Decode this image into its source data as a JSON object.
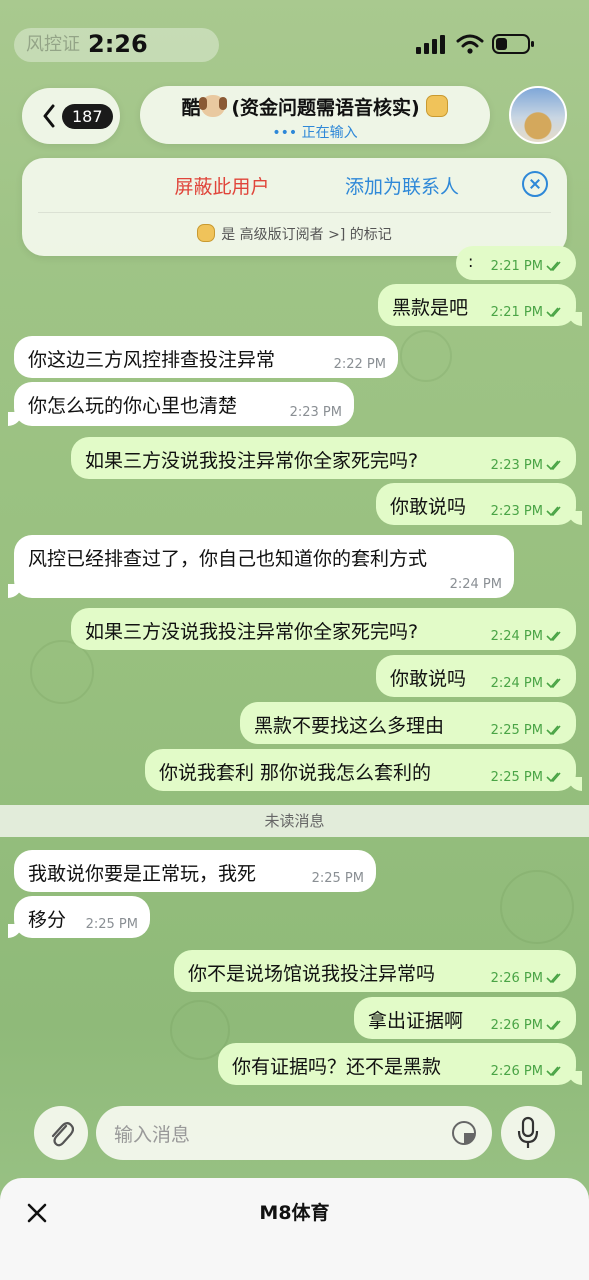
{
  "status_bar": {
    "time": "2:26",
    "faded_preview": "风控证"
  },
  "header": {
    "back_count": "187",
    "title": "酷",
    "title_rest": "(资金问题需语音核实)",
    "subtitle": "••• 正在输入"
  },
  "banner": {
    "block_label": "屏蔽此用户",
    "add_contact_label": "添加为联系人",
    "note_prefix": "是",
    "note_link": "高级版订阅者 >]",
    "note_suffix": "的标记"
  },
  "messages": [
    {
      "dir": "out",
      "text": ":",
      "time": "2:21 PM"
    },
    {
      "dir": "out",
      "text": "黑款是吧",
      "time": "2:21 PM"
    },
    {
      "dir": "in",
      "text": "你这边三方风控排查投注异常",
      "time": "2:22 PM"
    },
    {
      "dir": "in",
      "text": "你怎么玩的你心里也清楚",
      "time": "2:23 PM"
    },
    {
      "dir": "out",
      "text": "如果三方没说我投注异常你全家死完吗?",
      "time": "2:23 PM"
    },
    {
      "dir": "out",
      "text": "你敢说吗",
      "time": "2:23 PM"
    },
    {
      "dir": "in",
      "text": "风控已经排查过了，你自己也知道你的套利方式",
      "time": "2:24 PM"
    },
    {
      "dir": "out",
      "text": "如果三方没说我投注异常你全家死完吗?",
      "time": "2:24 PM"
    },
    {
      "dir": "out",
      "text": "你敢说吗",
      "time": "2:24 PM"
    },
    {
      "dir": "out",
      "text": "黑款不要找这么多理由",
      "time": "2:25 PM"
    },
    {
      "dir": "out",
      "text": "你说我套利 那你说我怎么套利的",
      "time": "2:25 PM"
    },
    {
      "dir": "in",
      "text": "我敢说你要是正常玩，我死",
      "time": "2:25 PM"
    },
    {
      "dir": "in",
      "text": "移分",
      "time": "2:25 PM"
    },
    {
      "dir": "out",
      "text": "你不是说场馆说我投注异常吗",
      "time": "2:26 PM"
    },
    {
      "dir": "out",
      "text": "拿出证据啊",
      "time": "2:26 PM"
    },
    {
      "dir": "out",
      "text": "你有证据吗？还不是黑款",
      "time": "2:26 PM"
    }
  ],
  "unread_label": "未读消息",
  "composer": {
    "placeholder": "输入消息"
  },
  "bottom_sheet": {
    "title": "M8体育"
  }
}
